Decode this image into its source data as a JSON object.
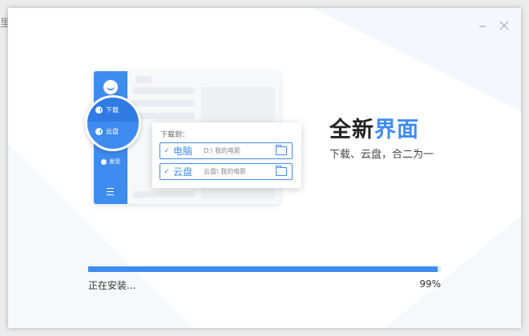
{
  "corner_text": "里",
  "window": {
    "minimize_label": "—",
    "close_label": "✕"
  },
  "illustration": {
    "sidebar": {
      "download_label": "下载",
      "cloud_label": "云盘",
      "extra_label": "发现"
    },
    "popup": {
      "title": "下载到：",
      "options": [
        {
          "name": "电脑",
          "path": "D:\\ 我的电影",
          "checked": true
        },
        {
          "name": "云盘",
          "path": "云盘\\ 我的电影",
          "checked": true
        }
      ]
    }
  },
  "heading": {
    "part1": "全新",
    "part2": "界面"
  },
  "subheading": "下载、云盘，合二为一",
  "install": {
    "status": "正在安装...",
    "percent_label": "99%",
    "progress": 0.99
  },
  "colors": {
    "accent": "#3f8cf0",
    "window_bg": "#ffffff"
  }
}
